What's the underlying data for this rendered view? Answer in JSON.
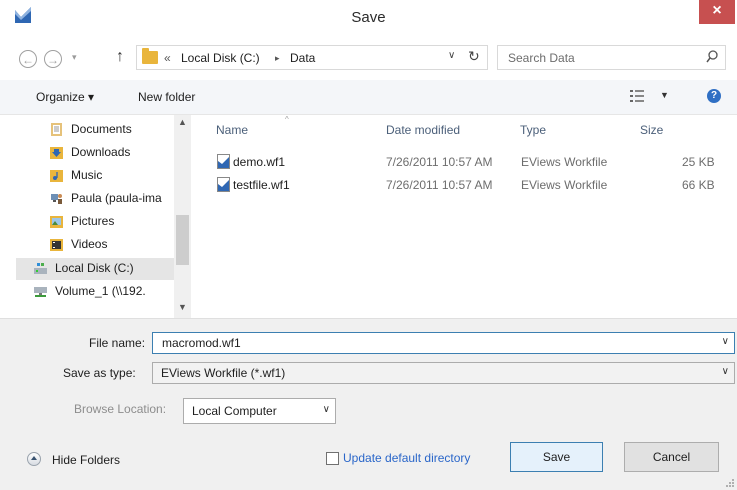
{
  "window": {
    "title": "Save",
    "close_glyph": "×"
  },
  "nav": {
    "back_glyph": "←",
    "forward_glyph": "→",
    "recent_glyph": "▾",
    "up_glyph": "↑",
    "breadcrumb_overflow": "«",
    "breadcrumb": [
      "Local Disk (C:)",
      "Data"
    ],
    "breadcrumb_separator": "▸",
    "address_dropdown_glyph": "∨",
    "refresh_glyph": "↻",
    "search_placeholder": "Search Data"
  },
  "toolbar": {
    "organize_label": "Organize ▾",
    "new_folder_label": "New folder",
    "view_dropdown_glyph": "▼",
    "help_glyph": "?"
  },
  "sidebar": {
    "items": [
      {
        "label": "Documents",
        "icon": "documents-icon"
      },
      {
        "label": "Downloads",
        "icon": "downloads-icon"
      },
      {
        "label": "Music",
        "icon": "music-icon"
      },
      {
        "label": "Paula (paula-ima",
        "icon": "user-network-icon"
      },
      {
        "label": "Pictures",
        "icon": "pictures-icon"
      },
      {
        "label": "Videos",
        "icon": "videos-icon"
      },
      {
        "label": "Local Disk (C:)",
        "icon": "local-disk-icon",
        "selected": true
      },
      {
        "label": "Volume_1 (\\\\192.",
        "icon": "network-drive-icon"
      }
    ],
    "scroll_up_glyph": "▲",
    "scroll_down_glyph": "▼"
  },
  "filelist": {
    "columns": [
      "Name",
      "Date modified",
      "Type",
      "Size"
    ],
    "sort_glyph": "^",
    "rows": [
      {
        "name": "demo.wf1",
        "date": "7/26/2011 10:57 AM",
        "type": "EViews Workfile",
        "size": "25 KB"
      },
      {
        "name": "testfile.wf1",
        "date": "7/26/2011 10:57 AM",
        "type": "EViews Workfile",
        "size": "66 KB"
      }
    ]
  },
  "form": {
    "file_name_label": "File name:",
    "file_name_value": "macromod.wf1",
    "save_as_type_label": "Save as type:",
    "save_as_type_value": "EViews Workfile (*.wf1)",
    "browse_location_label": "Browse Location:",
    "browse_location_value": "Local Computer",
    "dropdown_glyph": "∨"
  },
  "footer": {
    "hide_folders_label": "Hide Folders",
    "update_default_label": "Update default directory",
    "save_label": "Save",
    "cancel_label": "Cancel"
  },
  "colors": {
    "accent": "#3c7fb1",
    "link": "#2a66c9",
    "close": "#c75050",
    "folder": "#e9b53c"
  }
}
